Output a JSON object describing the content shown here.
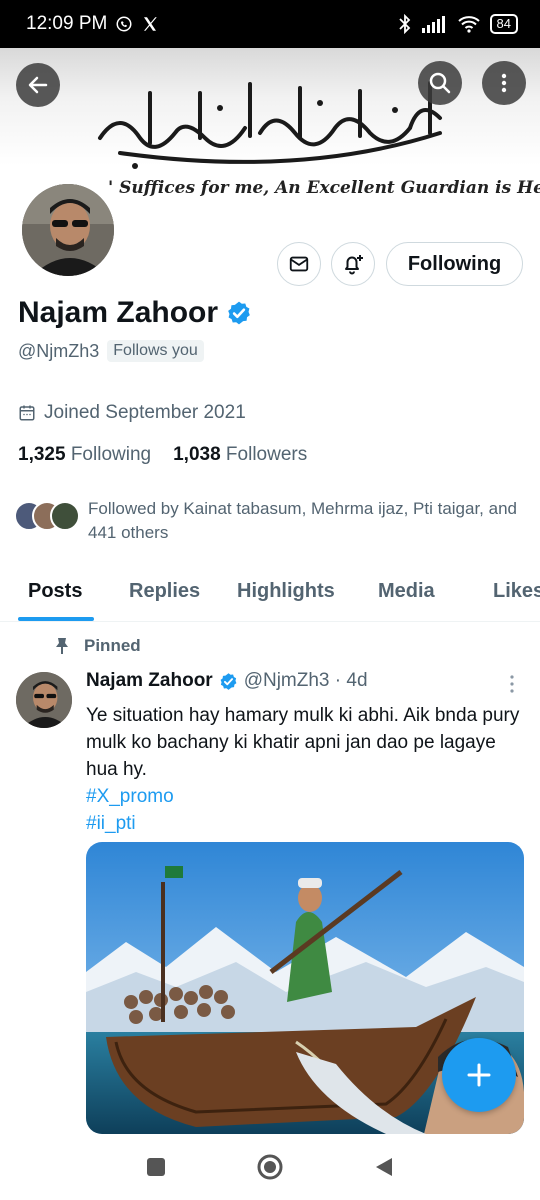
{
  "status_bar": {
    "time": "12:09 PM",
    "battery": "84"
  },
  "banner": {
    "caption": "' Suffices for me, An Excellent Guardian is He!"
  },
  "profile": {
    "name": "Najam Zahoor",
    "handle": "@NjmZh3",
    "follows_you": "Follows you",
    "joined": "Joined September 2021",
    "following_count": "1,325",
    "following_label": "Following",
    "followers_count": "1,038",
    "followers_label": "Followers",
    "followed_by": "Followed by Kainat tabasum, Mehrma ijaz, Pti taigar, and 441 others",
    "following_button": "Following"
  },
  "tabs": [
    "Posts",
    "Replies",
    "Highlights",
    "Media",
    "Likes"
  ],
  "tweet": {
    "pinned_label": "Pinned",
    "author": "Najam Zahoor",
    "handle_time": "@NjmZh3 · 4d",
    "text": "Ye situation hay hamary mulk ki abhi. Aik bnda pury mulk ko bachany ki khatir apni jan dao pe lagaye hua hy.",
    "hashtags": [
      "#X_promo",
      "#ii_pti"
    ]
  },
  "colors": {
    "accent": "#1d9bf0",
    "secondary_text": "#536471",
    "primary_text": "#0f1419"
  },
  "icons": [
    "whatsapp-icon",
    "x-logo-icon",
    "bluetooth-icon",
    "signal-icon",
    "wifi-icon",
    "back-arrow-icon",
    "search-icon",
    "more-vertical-icon",
    "mail-icon",
    "bell-plus-icon",
    "verified-badge-icon",
    "calendar-icon",
    "pin-icon",
    "compose-plus-icon",
    "nav-recents-icon",
    "nav-home-icon",
    "nav-back-icon"
  ]
}
